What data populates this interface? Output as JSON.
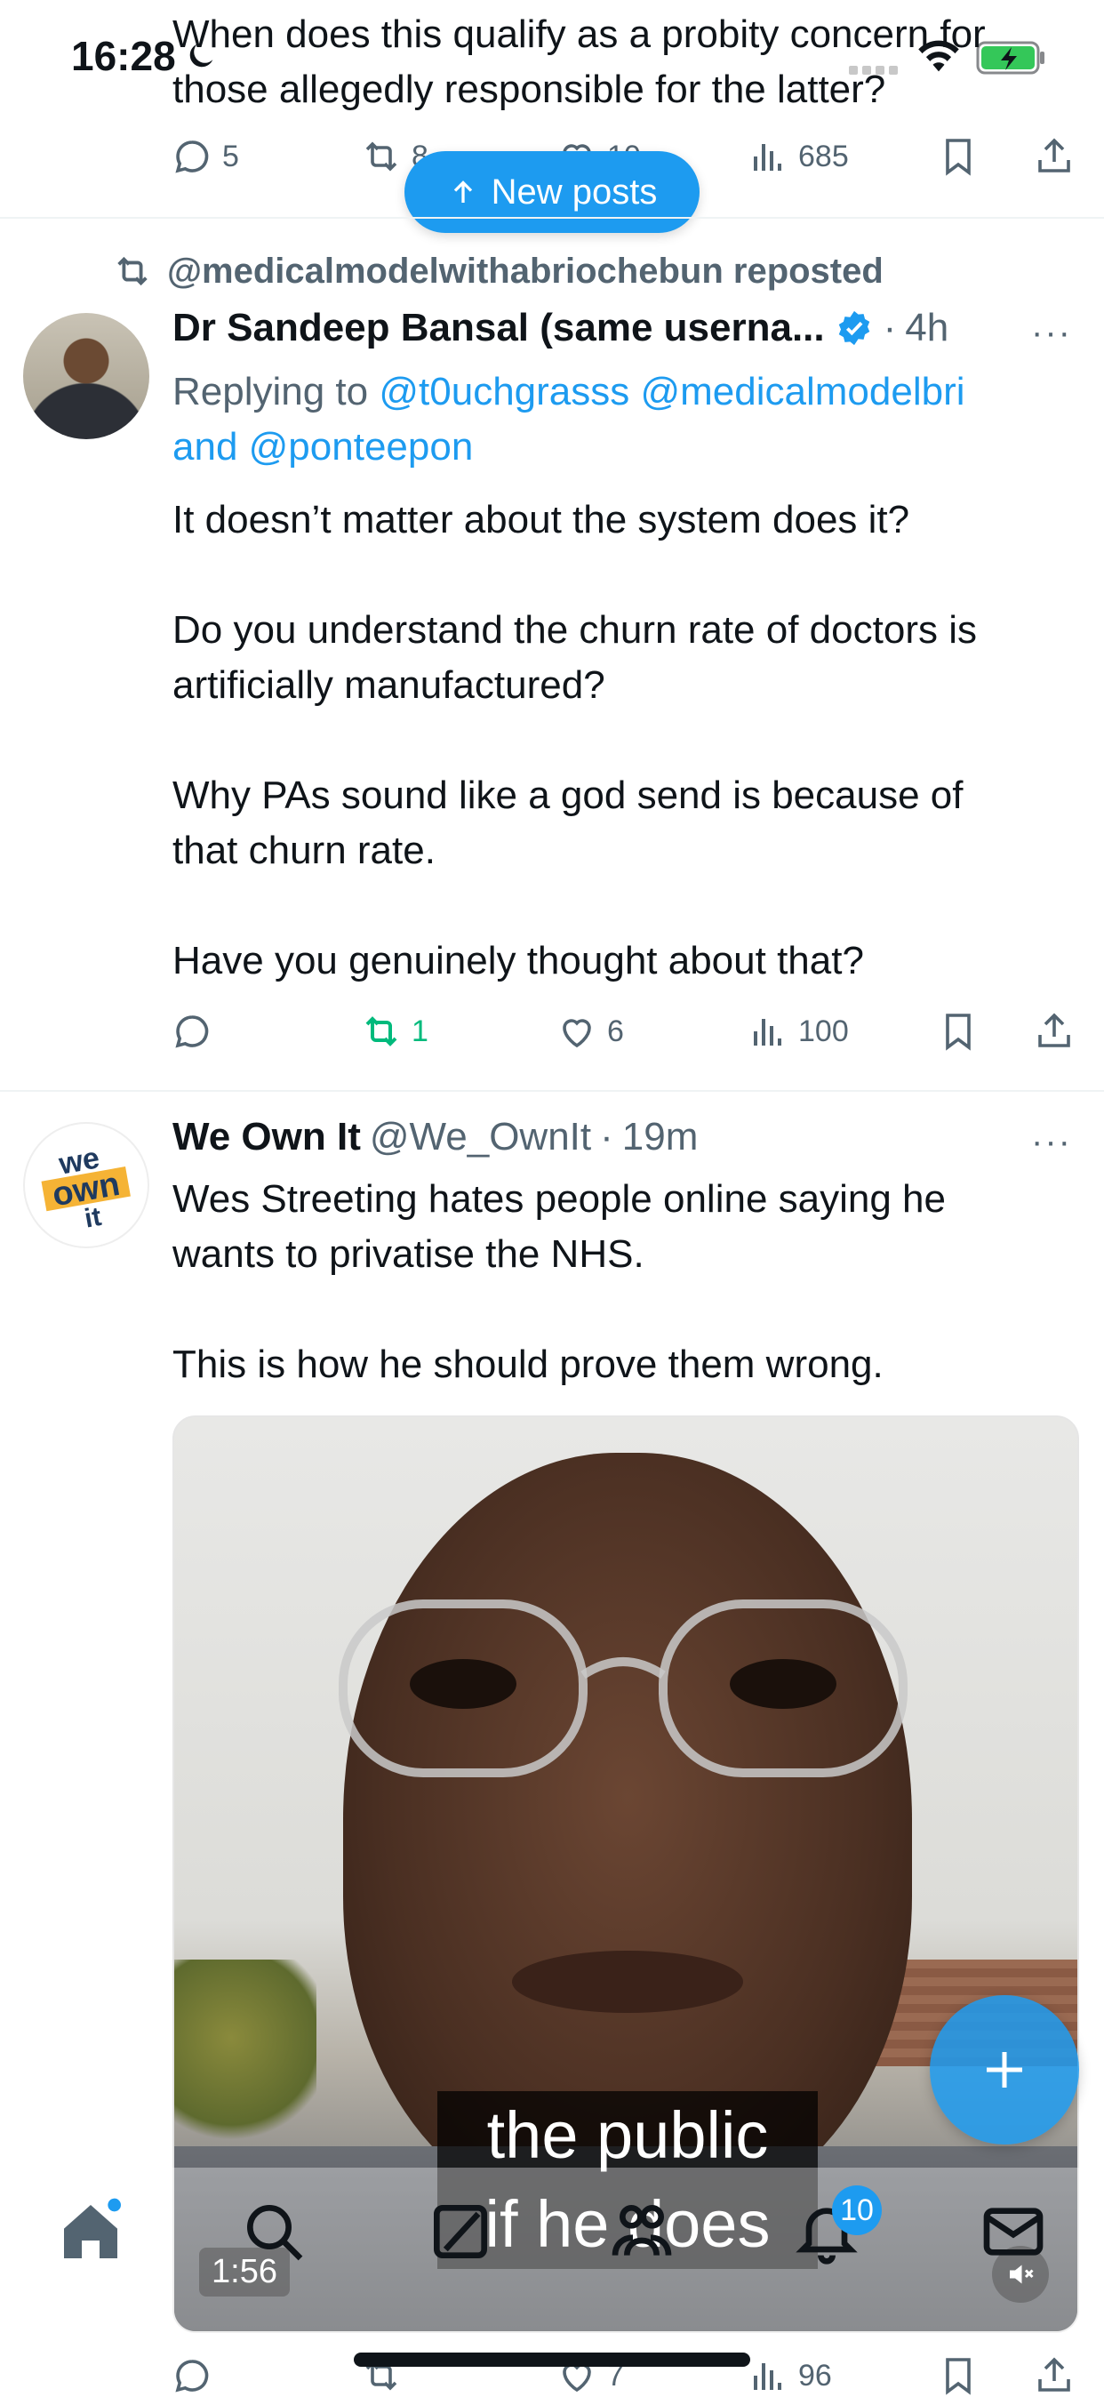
{
  "status_bar": {
    "time": "16:28"
  },
  "top_tweet": {
    "text_line1": "When does this qualify as a probity concern for",
    "text_line2": "those allegedly responsible for the latter?",
    "replies": "5",
    "retweets": "8",
    "likes": "10",
    "views": "685"
  },
  "new_posts_label": "New posts",
  "tweet2": {
    "repost_label": "@medicalmodelwithabriochebun reposted",
    "name": "Dr Sandeep Bansal (same userna...",
    "time": "4h",
    "replying_prefix": "Replying to ",
    "replying_to_1": "@t0uchgrasss @medicalmodelbri",
    "replying_and": "and ",
    "replying_to_2": "@ponteepon",
    "p1": "It doesn’t matter about the system does it?",
    "p2a": "Do you understand the churn rate of doctors is",
    "p2b": "artificially manufactured?",
    "p3a": "Why PAs sound like a god send is because of",
    "p3b": "that churn rate.",
    "p4": "Have you genuinely thought about that?",
    "retweets": "1",
    "likes": "6",
    "views": "100"
  },
  "tweet3": {
    "avatar_text": "we own it",
    "name": "We Own It",
    "handle": "@We_OwnIt",
    "time": "19m",
    "p1a": "Wes Streeting hates people online saying he",
    "p1b": "wants to privatise the NHS.",
    "p2": "This is how he should prove them wrong.",
    "video_duration": "1:56",
    "caption_line1": "the public",
    "caption_line2": "if he does",
    "likes": "7",
    "views": "96"
  },
  "tab_bar": {
    "notifications_badge": "10"
  },
  "colors": {
    "accent": "#1d9bf0",
    "retweet_active": "#00ba7c",
    "text": "#0f1419",
    "secondary": "#536471"
  }
}
